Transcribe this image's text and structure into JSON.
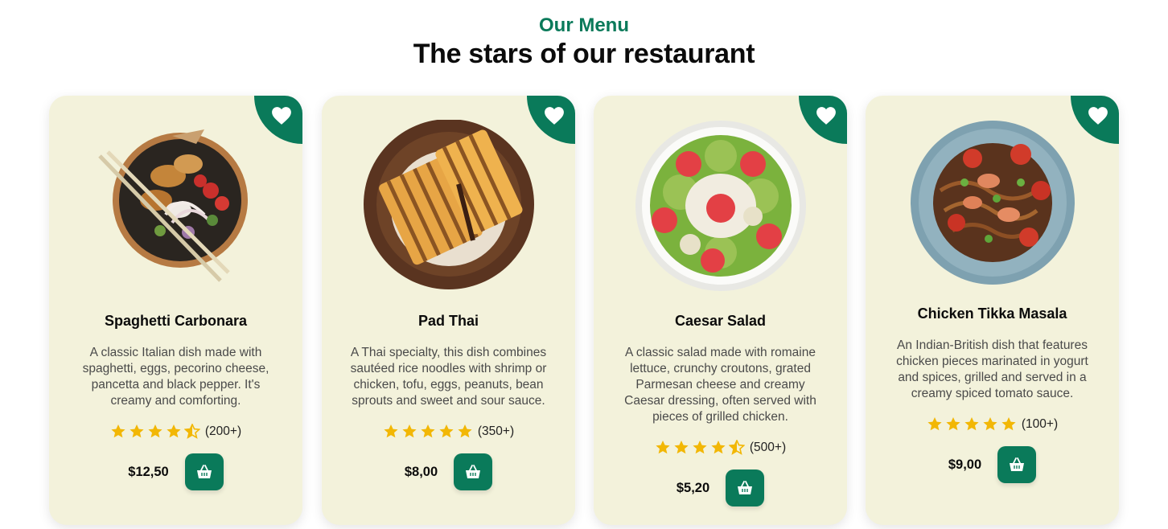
{
  "header": {
    "eyebrow": "Our Menu",
    "title": "The stars of our restaurant"
  },
  "colors": {
    "accent": "#0a7a5a",
    "card_background": "#f3f2db",
    "star": "#f2b705"
  },
  "icons": {
    "favorite": "heart-icon",
    "add_to_cart": "shopping-basket-icon",
    "rating": "star-icon"
  },
  "cards": [
    {
      "name": "Spaghetti Carbonara",
      "description": "A classic Italian dish made with spaghetti, eggs, pecorino cheese, pancetta and black pepper. It's creamy and comforting.",
      "rating": 4.5,
      "reviews": "(200+)",
      "price": "$12,50"
    },
    {
      "name": "Pad Thai",
      "description": "A Thai specialty, this dish combines sautéed rice noodles with shrimp or chicken, tofu, eggs, peanuts, bean sprouts and sweet and sour sauce.",
      "rating": 5,
      "reviews": "(350+)",
      "price": "$8,00"
    },
    {
      "name": "Caesar Salad",
      "description": "A classic salad made with romaine lettuce, crunchy croutons, grated Parmesan cheese and creamy Caesar dressing, often served with pieces of grilled chicken.",
      "rating": 4.5,
      "reviews": "(500+)",
      "price": "$5,20"
    },
    {
      "name": "Chicken Tikka Masala",
      "description": "An Indian-British dish that features chicken pieces marinated in yogurt and spices, grilled and served in a creamy spiced tomato sauce.",
      "rating": 5,
      "reviews": "(100+)",
      "price": "$9,00"
    }
  ]
}
